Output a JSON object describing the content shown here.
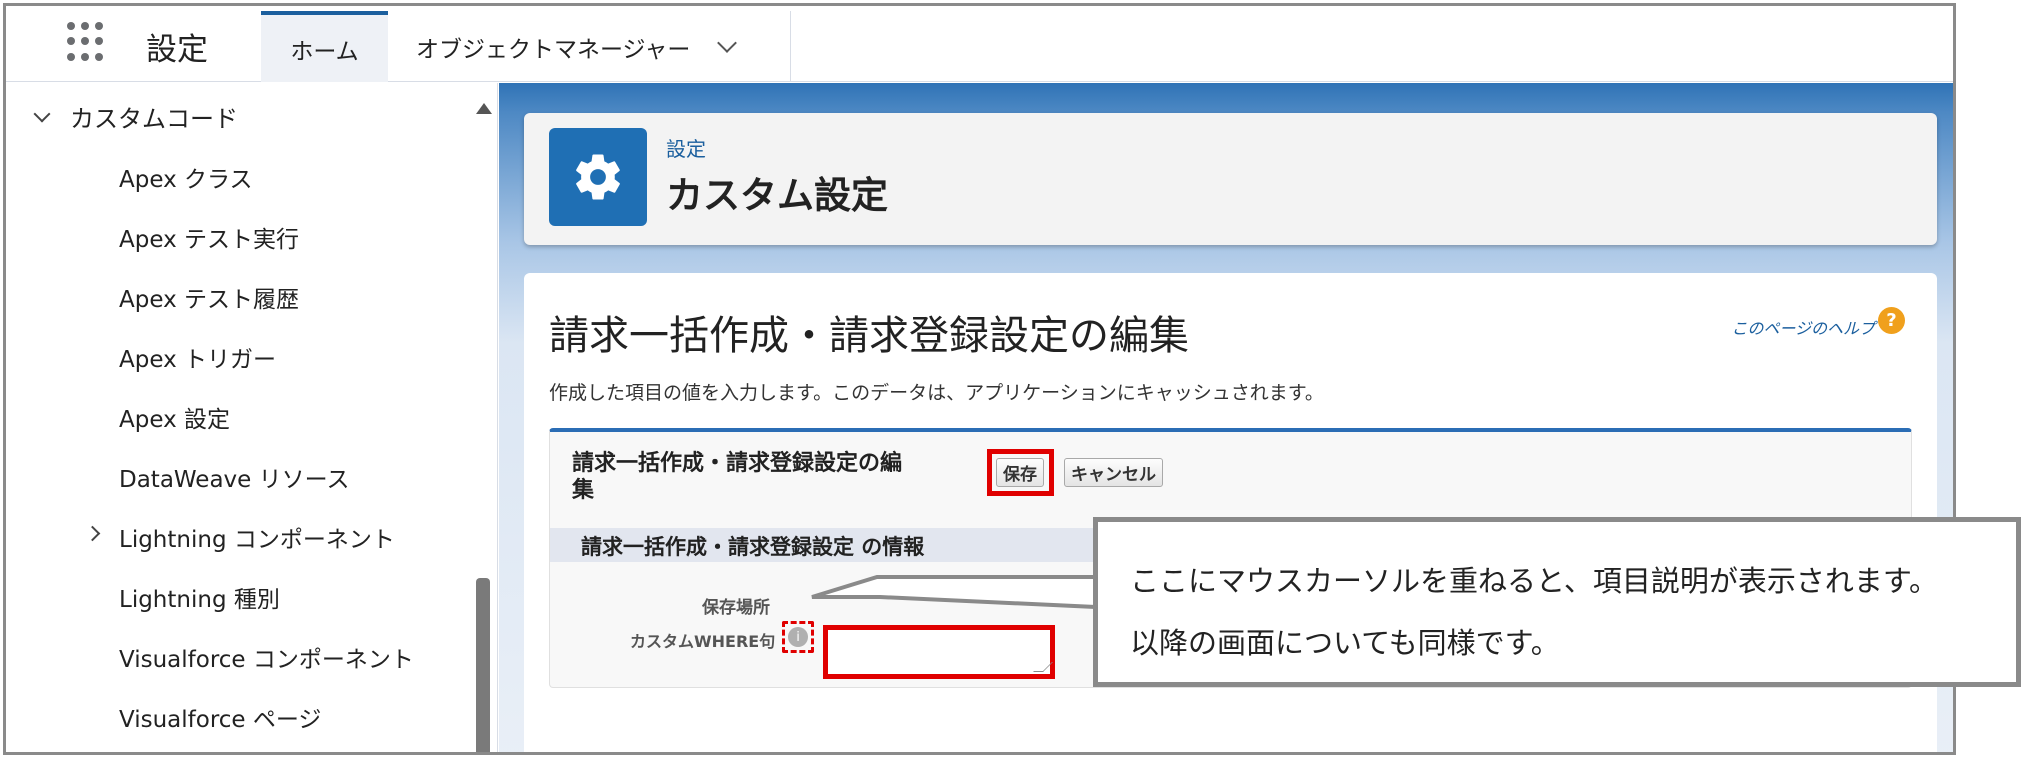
{
  "app": {
    "title": "設定"
  },
  "tabs": {
    "home": "ホーム",
    "object_manager": "オブジェクトマネージャー"
  },
  "sidebar": {
    "section": "カスタムコード",
    "items": [
      {
        "label": "Apex クラス"
      },
      {
        "label": "Apex テスト実行"
      },
      {
        "label": "Apex テスト履歴"
      },
      {
        "label": "Apex トリガー"
      },
      {
        "label": "Apex 設定"
      },
      {
        "label": "DataWeave リソース"
      },
      {
        "label": "Lightning コンポーネント"
      },
      {
        "label": "Lightning 種別"
      },
      {
        "label": "Visualforce コンポーネント"
      },
      {
        "label": "Visualforce ページ"
      }
    ]
  },
  "header": {
    "subtitle": "設定",
    "title": "カスタム設定"
  },
  "page": {
    "title": "請求一括作成・請求登録設定の編集",
    "help_link": "このページのヘルプ",
    "help_icon": "?",
    "description": "作成した項目の値を入力します。このデータは、アプリケーションにキャッシュされます。"
  },
  "edit": {
    "title": "請求一括作成・請求登録設定の編集",
    "save": "保存",
    "cancel": "キャンセル",
    "section_title": "請求一括作成・請求登録設定 の情報",
    "location_label": "保存場所",
    "where_label": "カスタムWHERE句",
    "where_value": ""
  },
  "callout": {
    "line1": "ここにマウスカーソルを重ねると、項目説明が表示されます。",
    "line2": "以降の画面についても同様です。"
  },
  "colors": {
    "brand": "#1f6fb4",
    "highlight": "#e00000",
    "help": "#f0a01c"
  }
}
